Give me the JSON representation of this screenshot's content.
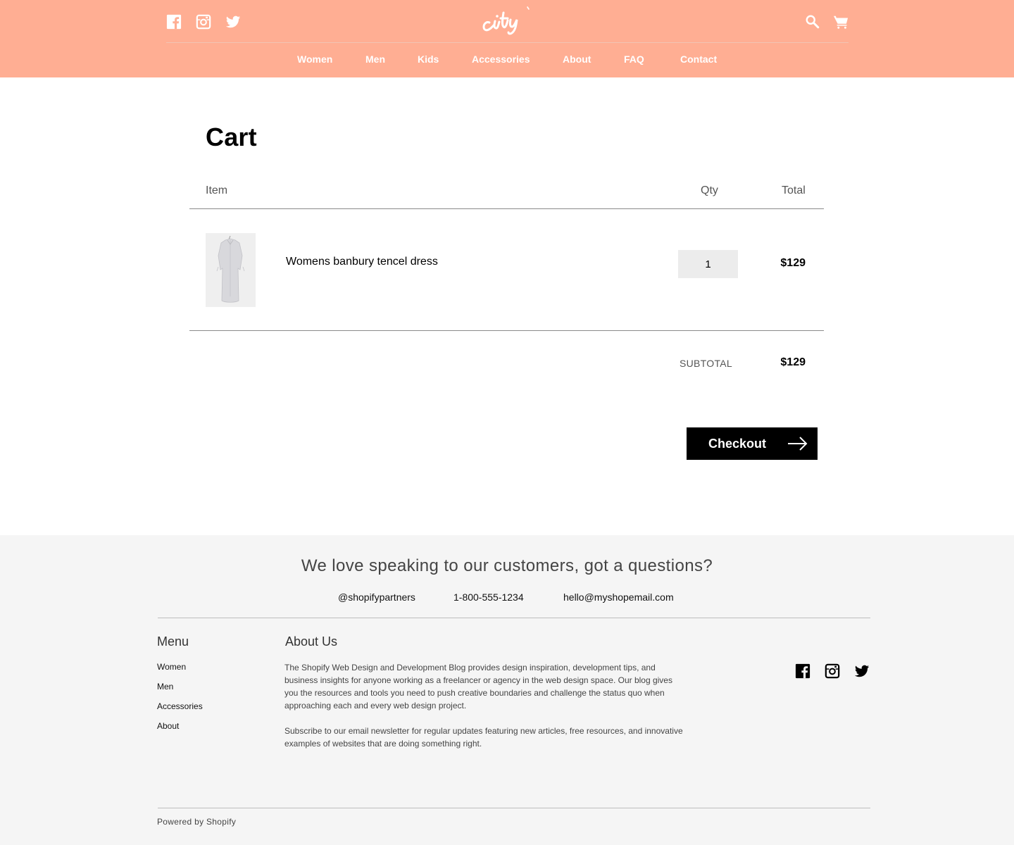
{
  "brand": {
    "logo_text": "city",
    "header_bg": "#ffae93",
    "footer_bg": "#f5f5f5"
  },
  "header": {
    "social_icons": [
      "facebook-icon",
      "instagram-icon",
      "twitter-icon"
    ],
    "right_icons": [
      "search-icon",
      "cart-icon"
    ],
    "nav": [
      "Women",
      "Men",
      "Kids",
      "Accessories",
      "About",
      "FAQ",
      "Contact"
    ]
  },
  "cart": {
    "title": "Cart",
    "columns": {
      "item": "Item",
      "qty": "Qty",
      "total": "Total"
    },
    "items": [
      {
        "name": "Womens banbury tencel dress",
        "qty": "1",
        "total": "$129",
        "image": "dress-image"
      }
    ],
    "subtotal_label": "SUBTOTAL",
    "subtotal_value": "$129",
    "checkout_label": "Checkout"
  },
  "footer": {
    "tagline": "We love speaking to our customers, got a questions?",
    "contacts": [
      "@shopifypartners",
      "1-800-555-1234",
      "hello@myshopemail.com"
    ],
    "menu_title": "Menu",
    "menu_items": [
      "Women",
      "Men",
      "Accessories",
      "About"
    ],
    "about_title": "About Us",
    "about_p1": "The Shopify Web Design and Development Blog provides design inspiration, development tips, and business insights for anyone working as a freelancer or agency in the web design space. Our blog gives you the resources and tools you need to push creative boundaries and challenge the status quo when approaching each and every web design project.",
    "about_p2": "Subscribe to our email newsletter for regular updates featuring new articles, free resources, and innovative examples of websites that are doing something right.",
    "social_icons": [
      "facebook-icon",
      "instagram-icon",
      "twitter-icon"
    ],
    "powered_by": "Powered by Shopify"
  }
}
